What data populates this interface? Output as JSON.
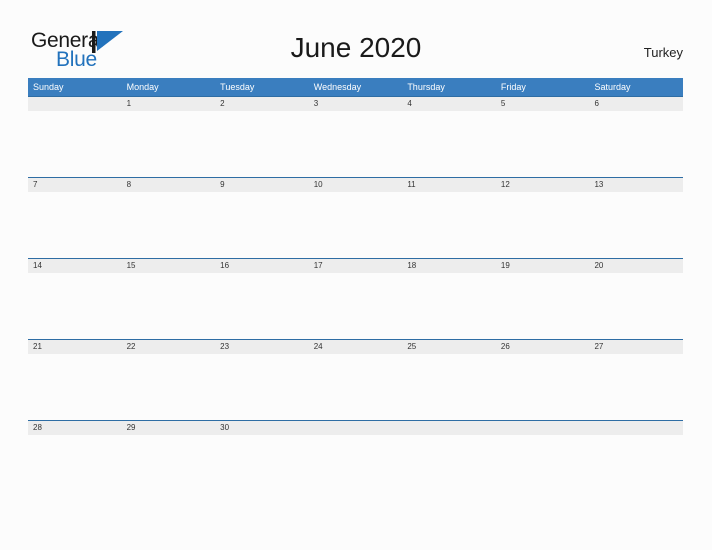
{
  "brand": {
    "name_part1": "General",
    "name_part2": "Blue",
    "mark_icon": "blue-triangle-logo-icon",
    "color_dark": "#1a1a1a",
    "color_blue": "#2272bc"
  },
  "header": {
    "title": "June 2020",
    "month": "June",
    "year": "2020",
    "region": "Turkey"
  },
  "colors": {
    "header_blue": "#3a7ebf",
    "row_divider_blue": "#2e6da4",
    "date_band_gray": "#ededed",
    "page_background": "#fcfcfc",
    "date_text": "#333333"
  },
  "calendar": {
    "weekdays": [
      "Sunday",
      "Monday",
      "Tuesday",
      "Wednesday",
      "Thursday",
      "Friday",
      "Saturday"
    ],
    "weeks": [
      [
        "",
        "1",
        "2",
        "3",
        "4",
        "5",
        "6"
      ],
      [
        "7",
        "8",
        "9",
        "10",
        "11",
        "12",
        "13"
      ],
      [
        "14",
        "15",
        "16",
        "17",
        "18",
        "19",
        "20"
      ],
      [
        "21",
        "22",
        "23",
        "24",
        "25",
        "26",
        "27"
      ],
      [
        "28",
        "29",
        "30",
        "",
        "",
        "",
        ""
      ]
    ]
  }
}
